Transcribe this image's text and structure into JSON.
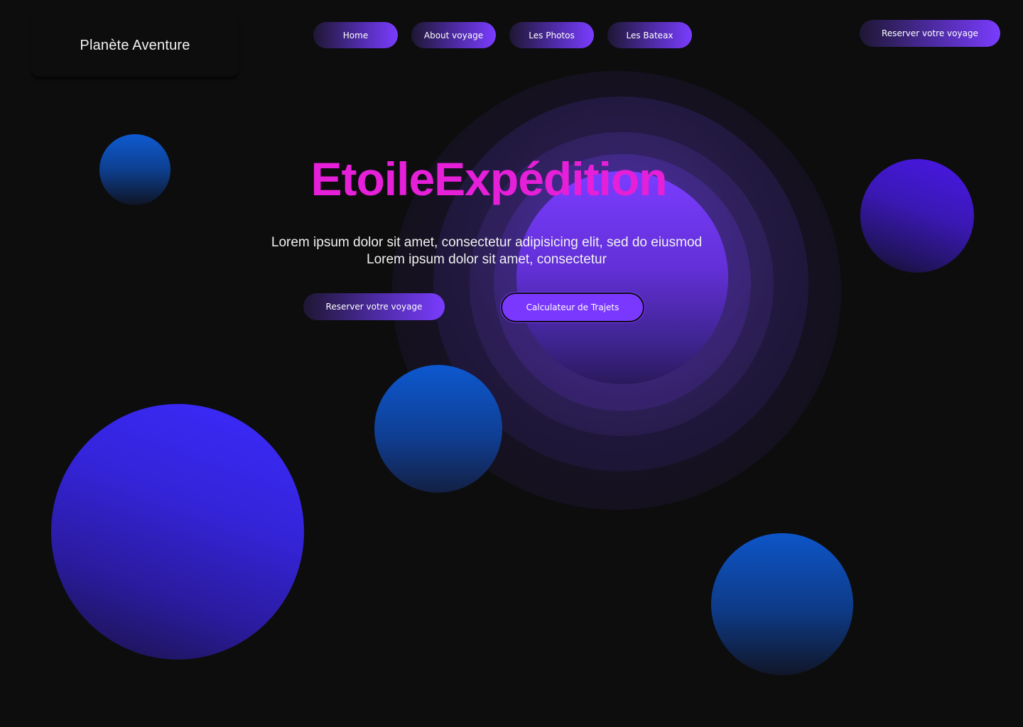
{
  "brand": {
    "name": "Planète Aventure"
  },
  "nav": {
    "items": [
      {
        "label": "Home"
      },
      {
        "label": "About voyage"
      },
      {
        "label": "Les Photos"
      },
      {
        "label": "Les Bateax"
      }
    ],
    "cta_label": "Reserver votre voyage"
  },
  "hero": {
    "title": "EtoileExpédition",
    "subtitle_line1": "Lorem ipsum dolor sit amet, consectetur adipisicing elit, sed do eiusmod",
    "subtitle_line2": "Lorem ipsum dolor sit amet, consectetur",
    "primary_button": "Reserver votre voyage",
    "secondary_button": "Calculateur de Trajets"
  },
  "colors": {
    "background": "#0d0d0e",
    "accent_purple": "#7a38ff",
    "title_magenta": "#e61fd9",
    "orb_blue": "#0d58cf",
    "orb_indigo": "#3b2bff"
  }
}
